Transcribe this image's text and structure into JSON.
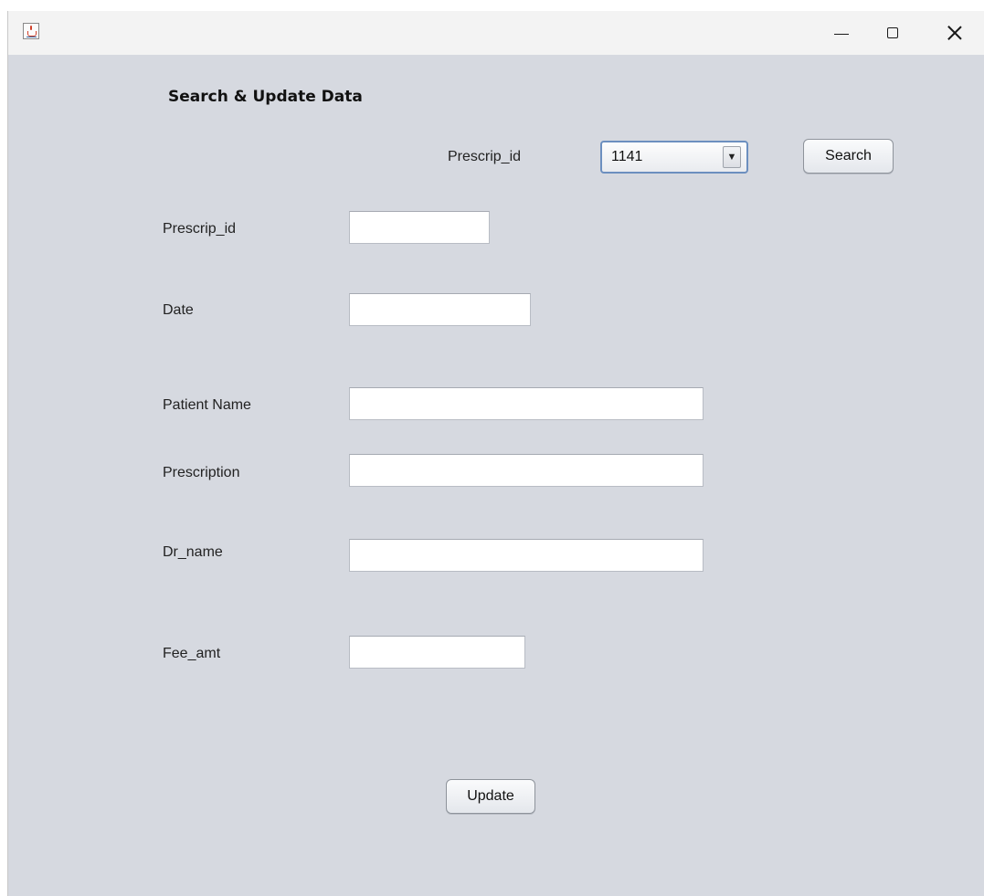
{
  "window": {
    "icon": "java-cup-icon"
  },
  "form": {
    "heading": "Search & Update Data",
    "search_label": "Prescrip_id",
    "search_selected": "1141",
    "search_button": "Search",
    "fields": {
      "prescrip_id": {
        "label": "Prescrip_id",
        "value": ""
      },
      "date": {
        "label": "Date",
        "value": ""
      },
      "patient_name": {
        "label": "Patient Name",
        "value": ""
      },
      "prescription": {
        "label": "Prescription",
        "value": ""
      },
      "dr_name": {
        "label": "Dr_name",
        "value": ""
      },
      "fee_amt": {
        "label": "Fee_amt",
        "value": ""
      }
    },
    "update_button": "Update"
  }
}
